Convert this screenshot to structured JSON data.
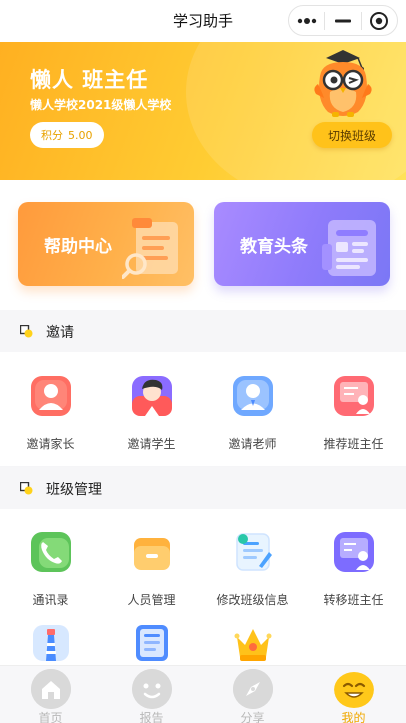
{
  "nav": {
    "title": "学习助手"
  },
  "hero": {
    "name": "懒人 班主任",
    "school": "懒人学校2021级懒人学校",
    "points_label": "积分",
    "points_value": "5.00",
    "switch_label": "切换班级"
  },
  "cards": [
    {
      "label": "帮助中心",
      "icon": "document-search-icon"
    },
    {
      "label": "教育头条",
      "icon": "newspaper-icon"
    }
  ],
  "invite": {
    "title": "邀请",
    "items": [
      {
        "label": "邀请家长",
        "icon": "parent-avatar-icon"
      },
      {
        "label": "邀请学生",
        "icon": "student-avatar-icon"
      },
      {
        "label": "邀请老师",
        "icon": "teacher-avatar-icon"
      },
      {
        "label": "推荐班主任",
        "icon": "blackboard-teacher-icon"
      }
    ]
  },
  "class_mgmt": {
    "title": "班级管理",
    "items": [
      {
        "label": "通讯录",
        "icon": "phone-icon"
      },
      {
        "label": "人员管理",
        "icon": "folder-icon"
      },
      {
        "label": "修改班级信息",
        "icon": "edit-document-icon"
      },
      {
        "label": "转移班主任",
        "icon": "transfer-teacher-icon"
      },
      {
        "label": "",
        "icon": "lighthouse-icon"
      },
      {
        "label": "",
        "icon": "notebook-icon"
      },
      {
        "label": "",
        "icon": "crown-icon"
      }
    ]
  },
  "tabbar": {
    "items": [
      {
        "label": "首页",
        "icon": "home-icon"
      },
      {
        "label": "报告",
        "icon": "face-icon"
      },
      {
        "label": "分享",
        "icon": "compass-icon"
      },
      {
        "label": "我的",
        "icon": "smiley-icon"
      }
    ],
    "active_index": 3
  },
  "colors": {
    "accent": "#ffc21a",
    "hero_start": "#ffb021",
    "hero_end": "#ffe25a",
    "tab_active": "#f0a800"
  }
}
